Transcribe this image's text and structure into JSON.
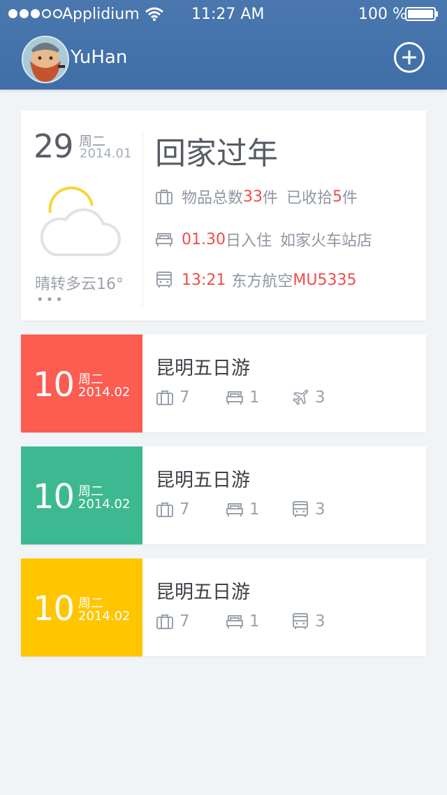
{
  "status_bar": {
    "carrier": "Applidium",
    "time": "11:27 AM",
    "battery": "100 %",
    "signal_strength": 3
  },
  "header": {
    "username": "YuHan"
  },
  "main_trip": {
    "day": "29",
    "weekday": "周二",
    "date": "2014.01",
    "weather": "晴转多云16°",
    "more": "•••",
    "title": "回家过年",
    "items": {
      "total_label": "物品总数",
      "total_count": "33",
      "total_unit": "件",
      "packed_label": "已收拾",
      "packed_count": "5",
      "packed_unit": "件"
    },
    "hotel": {
      "date": "01.30",
      "checkin_label": "日入住",
      "name": "如家火车站店"
    },
    "transport": {
      "time": "13:21",
      "airline": "东方航空",
      "flight": "MU5335"
    }
  },
  "trips": [
    {
      "day": "10",
      "weekday": "周二",
      "date": "2014.02",
      "title": "昆明五日游",
      "luggage": "7",
      "hotel": "1",
      "transport": "3",
      "transport_icon": "plane-icon",
      "color": "#fd5c51"
    },
    {
      "day": "10",
      "weekday": "周二",
      "date": "2014.02",
      "title": "昆明五日游",
      "luggage": "7",
      "hotel": "1",
      "transport": "3",
      "transport_icon": "bus-icon",
      "color": "#3db991"
    },
    {
      "day": "10",
      "weekday": "周二",
      "date": "2014.02",
      "title": "昆明五日游",
      "luggage": "7",
      "hotel": "1",
      "transport": "3",
      "transport_icon": "bus-icon",
      "color": "#ffc600"
    }
  ],
  "colors": {
    "header": "#4a77ae",
    "accent_red": "#f24b4b",
    "icon_gray": "#9aa1ac",
    "sun_yellow": "#f6d63a"
  }
}
